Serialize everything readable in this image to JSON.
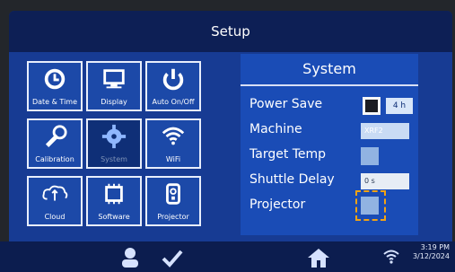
{
  "app": {
    "title": "Setup"
  },
  "tiles": [
    {
      "name": "date-time",
      "label": "Date & Time",
      "icon": "clock-icon"
    },
    {
      "name": "display",
      "label": "Display",
      "icon": "monitor-icon"
    },
    {
      "name": "auto-on-off",
      "label": "Auto On/Off",
      "icon": "power-icon"
    },
    {
      "name": "calibration",
      "label": "Calibration",
      "icon": "wrench-icon"
    },
    {
      "name": "system",
      "label": "System",
      "icon": "gear-icon"
    },
    {
      "name": "wifi",
      "label": "WiFi",
      "icon": "wifi-icon"
    },
    {
      "name": "cloud",
      "label": "Cloud",
      "icon": "cloud-sync-icon"
    },
    {
      "name": "software",
      "label": "Software",
      "icon": "chip-icon"
    },
    {
      "name": "projector",
      "label": "Projector",
      "icon": "projector-icon"
    }
  ],
  "panel": {
    "title": "System",
    "rows": [
      {
        "label": "Power Save",
        "value": "4 h"
      },
      {
        "label": "Machine",
        "value": "XRF2"
      },
      {
        "label": "Target Temp",
        "value": ""
      },
      {
        "label": "Shuttle Delay",
        "value": "0 s"
      },
      {
        "label": "Projector",
        "value": ""
      }
    ]
  },
  "bottom": {
    "time": "3:19 PM",
    "date": "3/12/2024"
  },
  "colors": {
    "screen_bg": "#173b93",
    "title_bg": "#0d1f55",
    "highlight": "#f2a314"
  }
}
